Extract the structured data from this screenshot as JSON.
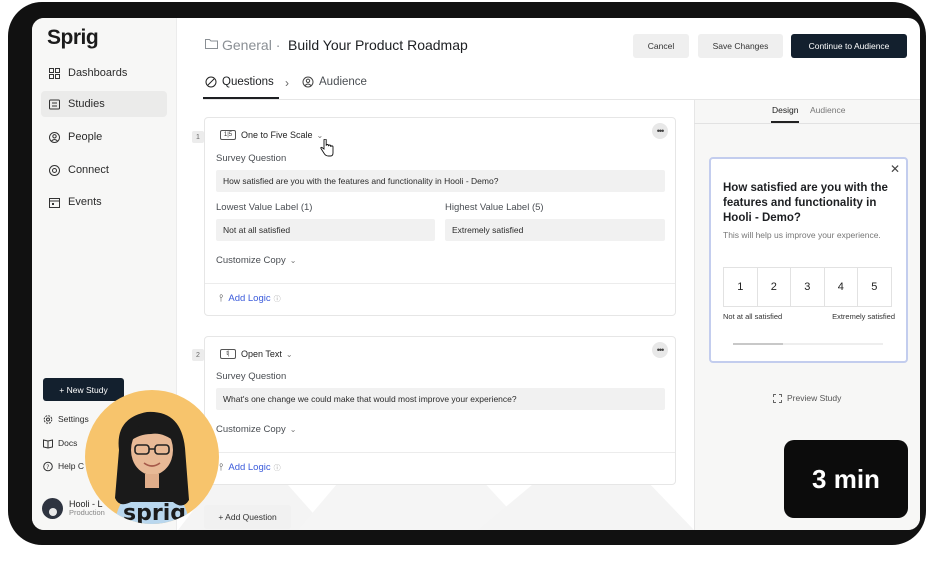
{
  "sidebar": {
    "logo": "Sprig",
    "nav": [
      {
        "label": "Dashboards",
        "icon": "grid-icon"
      },
      {
        "label": "Studies",
        "icon": "studies-icon"
      },
      {
        "label": "People",
        "icon": "person-icon"
      },
      {
        "label": "Connect",
        "icon": "connect-icon"
      },
      {
        "label": "Events",
        "icon": "events-icon"
      }
    ],
    "active_index": 1,
    "new_study_label": "+ New Study",
    "footer": [
      {
        "label": "Settings",
        "icon": "gear-icon"
      },
      {
        "label": "Docs",
        "icon": "book-icon"
      },
      {
        "label": "Help C",
        "icon": "help-icon"
      }
    ],
    "user": {
      "name": "Hooli - L",
      "env": "Production"
    }
  },
  "header": {
    "breadcrumb": "General ·",
    "title": "Build Your Product Roadmap",
    "cancel_label": "Cancel",
    "save_label": "Save Changes",
    "continue_label": "Continue to Audience"
  },
  "tabs": {
    "questions": "Questions",
    "arrow": "›",
    "audience": "Audience"
  },
  "questions": [
    {
      "number": "1",
      "type_label": "One to Five Scale",
      "type_icon_text": "1|5",
      "survey_label": "Survey Question",
      "question": "How satisfied are you with the features and functionality in Hooli - Demo?",
      "low_label_caption": "Lowest Value Label (1)",
      "low_label_value": "Not at all satisfied",
      "high_label_caption": "Highest Value Label (5)",
      "high_label_value": "Extremely satisfied",
      "customize": "Customize Copy",
      "add_logic": "Add Logic"
    },
    {
      "number": "2",
      "type_label": "Open Text",
      "type_icon_text": "t|",
      "survey_label": "Survey Question",
      "question": "What's one change we could make that would most improve your experience?",
      "customize": "Customize Copy",
      "add_logic": "Add Logic"
    }
  ],
  "add_question_label": "+ Add Question",
  "preview": {
    "tab_design": "Design",
    "tab_audience": "Audience",
    "question": "How satisfied are you with the features and functionality in Hooli - Demo?",
    "subtitle": "This will help us improve your experience.",
    "scale": [
      "1",
      "2",
      "3",
      "4",
      "5"
    ],
    "low": "Not at all satisfied",
    "high": "Extremely satisfied",
    "progress": 0.33,
    "preview_link": "Preview Study"
  },
  "webcam": {
    "shirt_text": "sprig"
  },
  "duration_badge": "3 min",
  "colors": {
    "primary_dark": "#13202e",
    "link_blue": "#3b5bdb",
    "preview_border": "#c3cdee"
  }
}
